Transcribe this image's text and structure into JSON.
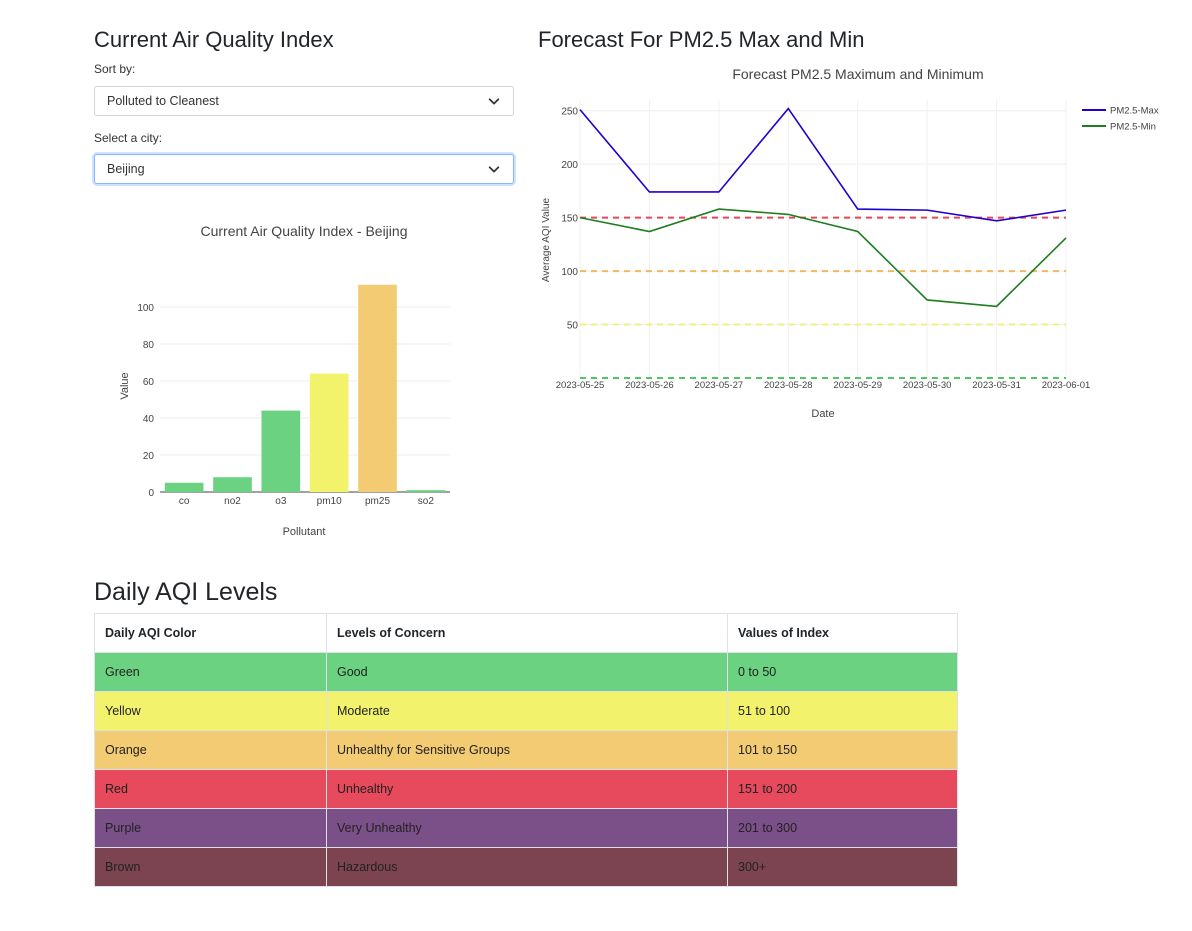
{
  "left": {
    "heading": "Current Air Quality Index",
    "sort_label": "Sort by:",
    "sort_value": "Polluted to Cleanest",
    "city_label": "Select a city:",
    "city_value": "Beijing"
  },
  "right": {
    "heading": "Forecast For PM2.5 Max and Min"
  },
  "bar_chart": {
    "type": "bar",
    "title": "Current Air Quality Index - Beijing",
    "xlabel": "Pollutant",
    "ylabel": "Value",
    "categories": [
      "co",
      "no2",
      "o3",
      "pm10",
      "pm25",
      "so2"
    ],
    "values": [
      5,
      8,
      44,
      64,
      112,
      1
    ],
    "colors": [
      "#6bd281",
      "#6bd281",
      "#6bd281",
      "#f3f36b",
      "#f3cb72",
      "#6bd281"
    ],
    "ylim": [
      0,
      120
    ],
    "yticks": [
      0,
      20,
      40,
      60,
      80,
      100
    ]
  },
  "chart_data": {
    "type": "line",
    "title": "Forecast PM2.5 Maximum and Minimum",
    "xlabel": "Date",
    "ylabel": "Average AQI Value",
    "x": [
      "2023-05-25",
      "2023-05-26",
      "2023-05-27",
      "2023-05-28",
      "2023-05-29",
      "2023-05-30",
      "2023-05-31",
      "2023-06-01"
    ],
    "series": [
      {
        "name": "PM2.5-Max",
        "color": "#1f00cc",
        "values": [
          251,
          174,
          174,
          252,
          158,
          157,
          147,
          157
        ]
      },
      {
        "name": "PM2.5-Min",
        "color": "#1e7d1e",
        "values": [
          150,
          137,
          158,
          153,
          137,
          73,
          67,
          131
        ]
      }
    ],
    "reference_lines": [
      {
        "value": 150,
        "color": "#e2485a"
      },
      {
        "value": 100,
        "color": "#f3b85f"
      },
      {
        "value": 50,
        "color": "#f3f07a"
      },
      {
        "value": 0,
        "color": "#4fc864"
      }
    ],
    "ylim": [
      0,
      260
    ],
    "yticks": [
      50,
      100,
      150,
      200,
      250
    ],
    "legend_position": "top-right"
  },
  "table": {
    "heading": "Daily AQI Levels",
    "headers": [
      "Daily AQI Color",
      "Levels of Concern",
      "Values of Index"
    ],
    "rows": [
      {
        "color": "Green",
        "concern": "Good",
        "range": "0 to 50",
        "bg": "#6bd281"
      },
      {
        "color": "Yellow",
        "concern": "Moderate",
        "range": "51 to 100",
        "bg": "#f2f26d"
      },
      {
        "color": "Orange",
        "concern": "Unhealthy for Sensitive Groups",
        "range": "101 to 150",
        "bg": "#f2cb72"
      },
      {
        "color": "Red",
        "concern": "Unhealthy",
        "range": "151 to 200",
        "bg": "#e74a5c"
      },
      {
        "color": "Purple",
        "concern": "Very Unhealthy",
        "range": "201 to 300",
        "bg": "#7b5088"
      },
      {
        "color": "Brown",
        "concern": "Hazardous",
        "range": "300+",
        "bg": "#7b4450"
      }
    ]
  }
}
